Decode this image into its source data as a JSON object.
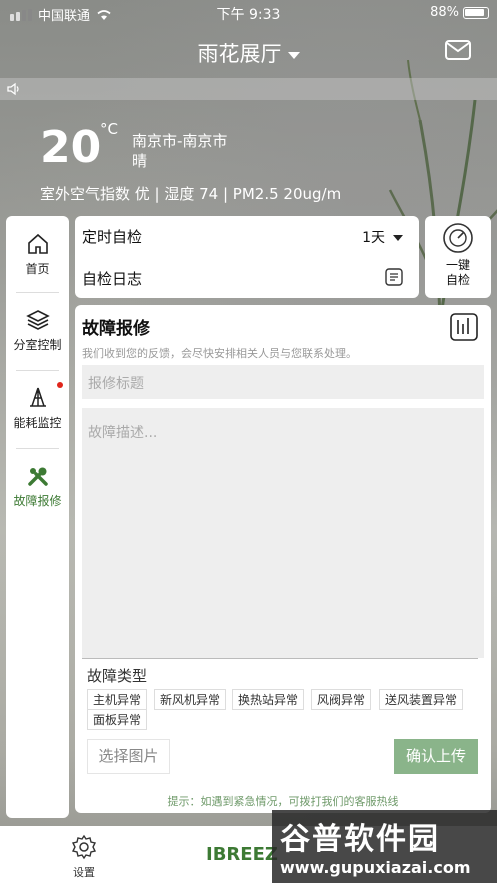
{
  "status": {
    "carrier": "中国联通",
    "time": "下午 9:33",
    "battery": "88%"
  },
  "header": {
    "title": "雨花展厅"
  },
  "weather": {
    "temp": "20",
    "unit": "°C",
    "city": "南京市-南京市",
    "condition": "晴",
    "aqi_line": "室外空气指数 优 | 湿度 74 | PM2.5 20ug/m"
  },
  "sidebar": {
    "items": [
      {
        "label": "首页"
      },
      {
        "label": "分室控制"
      },
      {
        "label": "能耗监控"
      },
      {
        "label": "故障报修"
      }
    ]
  },
  "selfcheck": {
    "timer_label": "定时自检",
    "interval": "1天",
    "log_label": "自检日志",
    "one_key_line1": "一键",
    "one_key_line2": "自检"
  },
  "repair": {
    "title": "故障报修",
    "subtitle": "我们收到您的反馈，会尽快安排相关人员与您联系处理。",
    "title_placeholder": "报修标题",
    "desc_placeholder": "故障描述...",
    "type_label": "故障类型",
    "types": [
      "主机异常",
      "新风机异常",
      "换热站异常",
      "风阀异常",
      "送风装置异常",
      "面板异常"
    ],
    "choose_image": "选择图片",
    "submit": "确认上传",
    "hint": "提示：如遇到紧急情况，可拨打我们的客服热线"
  },
  "bottom": {
    "settings_label": "设置",
    "brand": "IBREEZ"
  },
  "watermark": {
    "line1": "谷普软件园",
    "line2": "www.gupuxiazai.com"
  },
  "colors": {
    "accent_green": "#3d7a34",
    "submit_bg": "#8ab48a",
    "badge_red": "#e0261b"
  }
}
